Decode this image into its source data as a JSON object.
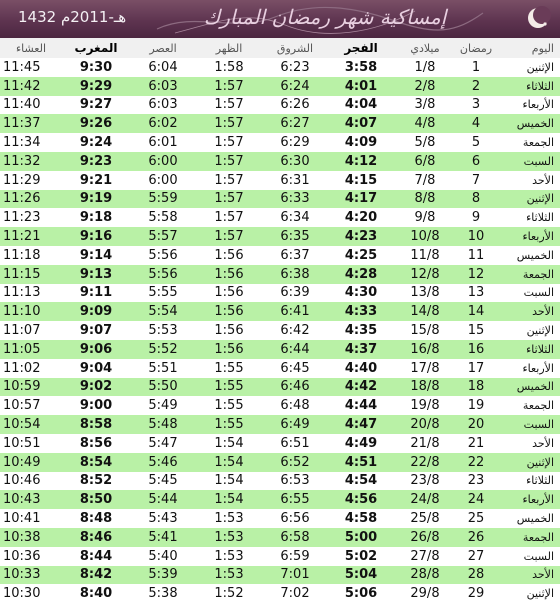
{
  "header": {
    "title": "إمساكية شهر رمضان المبارك",
    "year": "1432 هـ-2011م"
  },
  "columns": {
    "day": "اليوم",
    "ramadan": "رمضان",
    "date": "ميلادي",
    "fajr": "الفجر",
    "sunrise": "الشروق",
    "dhuhr": "الظهر",
    "asr": "العصر",
    "maghrib": "المغرب",
    "isha": "العشاء"
  },
  "rows": [
    {
      "day": "الإثنين",
      "ramadan": "1",
      "date": "1/8",
      "fajr": "3:58",
      "sunrise": "6:23",
      "dhuhr": "1:58",
      "asr": "6:04",
      "maghrib": "9:30",
      "isha": "11:45"
    },
    {
      "day": "الثلاثاء",
      "ramadan": "2",
      "date": "2/8",
      "fajr": "4:01",
      "sunrise": "6:24",
      "dhuhr": "1:57",
      "asr": "6:03",
      "maghrib": "9:29",
      "isha": "11:42"
    },
    {
      "day": "الأربعاء",
      "ramadan": "3",
      "date": "3/8",
      "fajr": "4:04",
      "sunrise": "6:26",
      "dhuhr": "1:57",
      "asr": "6:03",
      "maghrib": "9:27",
      "isha": "11:40"
    },
    {
      "day": "الخميس",
      "ramadan": "4",
      "date": "4/8",
      "fajr": "4:07",
      "sunrise": "6:27",
      "dhuhr": "1:57",
      "asr": "6:02",
      "maghrib": "9:26",
      "isha": "11:37"
    },
    {
      "day": "الجمعة",
      "ramadan": "5",
      "date": "5/8",
      "fajr": "4:09",
      "sunrise": "6:29",
      "dhuhr": "1:57",
      "asr": "6:01",
      "maghrib": "9:24",
      "isha": "11:34"
    },
    {
      "day": "السبت",
      "ramadan": "6",
      "date": "6/8",
      "fajr": "4:12",
      "sunrise": "6:30",
      "dhuhr": "1:57",
      "asr": "6:00",
      "maghrib": "9:23",
      "isha": "11:32"
    },
    {
      "day": "الأحد",
      "ramadan": "7",
      "date": "7/8",
      "fajr": "4:15",
      "sunrise": "6:31",
      "dhuhr": "1:57",
      "asr": "6:00",
      "maghrib": "9:21",
      "isha": "11:29"
    },
    {
      "day": "الإثنين",
      "ramadan": "8",
      "date": "8/8",
      "fajr": "4:17",
      "sunrise": "6:33",
      "dhuhr": "1:57",
      "asr": "5:59",
      "maghrib": "9:19",
      "isha": "11:26"
    },
    {
      "day": "الثلاثاء",
      "ramadan": "9",
      "date": "9/8",
      "fajr": "4:20",
      "sunrise": "6:34",
      "dhuhr": "1:57",
      "asr": "5:58",
      "maghrib": "9:18",
      "isha": "11:23"
    },
    {
      "day": "الأربعاء",
      "ramadan": "10",
      "date": "10/8",
      "fajr": "4:23",
      "sunrise": "6:35",
      "dhuhr": "1:57",
      "asr": "5:57",
      "maghrib": "9:16",
      "isha": "11:21"
    },
    {
      "day": "الخميس",
      "ramadan": "11",
      "date": "11/8",
      "fajr": "4:25",
      "sunrise": "6:37",
      "dhuhr": "1:56",
      "asr": "5:56",
      "maghrib": "9:14",
      "isha": "11:18"
    },
    {
      "day": "الجمعة",
      "ramadan": "12",
      "date": "12/8",
      "fajr": "4:28",
      "sunrise": "6:38",
      "dhuhr": "1:56",
      "asr": "5:56",
      "maghrib": "9:13",
      "isha": "11:15"
    },
    {
      "day": "السبت",
      "ramadan": "13",
      "date": "13/8",
      "fajr": "4:30",
      "sunrise": "6:39",
      "dhuhr": "1:56",
      "asr": "5:55",
      "maghrib": "9:11",
      "isha": "11:13"
    },
    {
      "day": "الأحد",
      "ramadan": "14",
      "date": "14/8",
      "fajr": "4:33",
      "sunrise": "6:41",
      "dhuhr": "1:56",
      "asr": "5:54",
      "maghrib": "9:09",
      "isha": "11:10"
    },
    {
      "day": "الإثنين",
      "ramadan": "15",
      "date": "15/8",
      "fajr": "4:35",
      "sunrise": "6:42",
      "dhuhr": "1:56",
      "asr": "5:53",
      "maghrib": "9:07",
      "isha": "11:07"
    },
    {
      "day": "الثلاثاء",
      "ramadan": "16",
      "date": "16/8",
      "fajr": "4:37",
      "sunrise": "6:44",
      "dhuhr": "1:56",
      "asr": "5:52",
      "maghrib": "9:06",
      "isha": "11:05"
    },
    {
      "day": "الأربعاء",
      "ramadan": "17",
      "date": "17/8",
      "fajr": "4:40",
      "sunrise": "6:45",
      "dhuhr": "1:55",
      "asr": "5:51",
      "maghrib": "9:04",
      "isha": "11:02"
    },
    {
      "day": "الخميس",
      "ramadan": "18",
      "date": "18/8",
      "fajr": "4:42",
      "sunrise": "6:46",
      "dhuhr": "1:55",
      "asr": "5:50",
      "maghrib": "9:02",
      "isha": "10:59"
    },
    {
      "day": "الجمعة",
      "ramadan": "19",
      "date": "19/8",
      "fajr": "4:44",
      "sunrise": "6:48",
      "dhuhr": "1:55",
      "asr": "5:49",
      "maghrib": "9:00",
      "isha": "10:57"
    },
    {
      "day": "السبت",
      "ramadan": "20",
      "date": "20/8",
      "fajr": "4:47",
      "sunrise": "6:49",
      "dhuhr": "1:55",
      "asr": "5:48",
      "maghrib": "8:58",
      "isha": "10:54"
    },
    {
      "day": "الأحد",
      "ramadan": "21",
      "date": "21/8",
      "fajr": "4:49",
      "sunrise": "6:51",
      "dhuhr": "1:54",
      "asr": "5:47",
      "maghrib": "8:56",
      "isha": "10:51"
    },
    {
      "day": "الإثنين",
      "ramadan": "22",
      "date": "22/8",
      "fajr": "4:51",
      "sunrise": "6:52",
      "dhuhr": "1:54",
      "asr": "5:46",
      "maghrib": "8:54",
      "isha": "10:49"
    },
    {
      "day": "الثلاثاء",
      "ramadan": "23",
      "date": "23/8",
      "fajr": "4:54",
      "sunrise": "6:53",
      "dhuhr": "1:54",
      "asr": "5:45",
      "maghrib": "8:52",
      "isha": "10:46"
    },
    {
      "day": "الأربعاء",
      "ramadan": "24",
      "date": "24/8",
      "fajr": "4:56",
      "sunrise": "6:55",
      "dhuhr": "1:54",
      "asr": "5:44",
      "maghrib": "8:50",
      "isha": "10:43"
    },
    {
      "day": "الخميس",
      "ramadan": "25",
      "date": "25/8",
      "fajr": "4:58",
      "sunrise": "6:56",
      "dhuhr": "1:53",
      "asr": "5:43",
      "maghrib": "8:48",
      "isha": "10:41"
    },
    {
      "day": "الجمعة",
      "ramadan": "26",
      "date": "26/8",
      "fajr": "5:00",
      "sunrise": "6:58",
      "dhuhr": "1:53",
      "asr": "5:41",
      "maghrib": "8:46",
      "isha": "10:38"
    },
    {
      "day": "السبت",
      "ramadan": "27",
      "date": "27/8",
      "fajr": "5:02",
      "sunrise": "6:59",
      "dhuhr": "1:53",
      "asr": "5:40",
      "maghrib": "8:44",
      "isha": "10:36"
    },
    {
      "day": "الأحد",
      "ramadan": "28",
      "date": "28/8",
      "fajr": "5:04",
      "sunrise": "7:01",
      "dhuhr": "1:53",
      "asr": "5:39",
      "maghrib": "8:42",
      "isha": "10:33"
    },
    {
      "day": "الإثنين",
      "ramadan": "29",
      "date": "29/8",
      "fajr": "5:06",
      "sunrise": "7:02",
      "dhuhr": "1:52",
      "asr": "5:38",
      "maghrib": "8:40",
      "isha": "10:30"
    }
  ],
  "colors": {
    "header_bg": "#5e3450",
    "row_alt": "#b9f1a6",
    "row_base": "#ffffff"
  }
}
